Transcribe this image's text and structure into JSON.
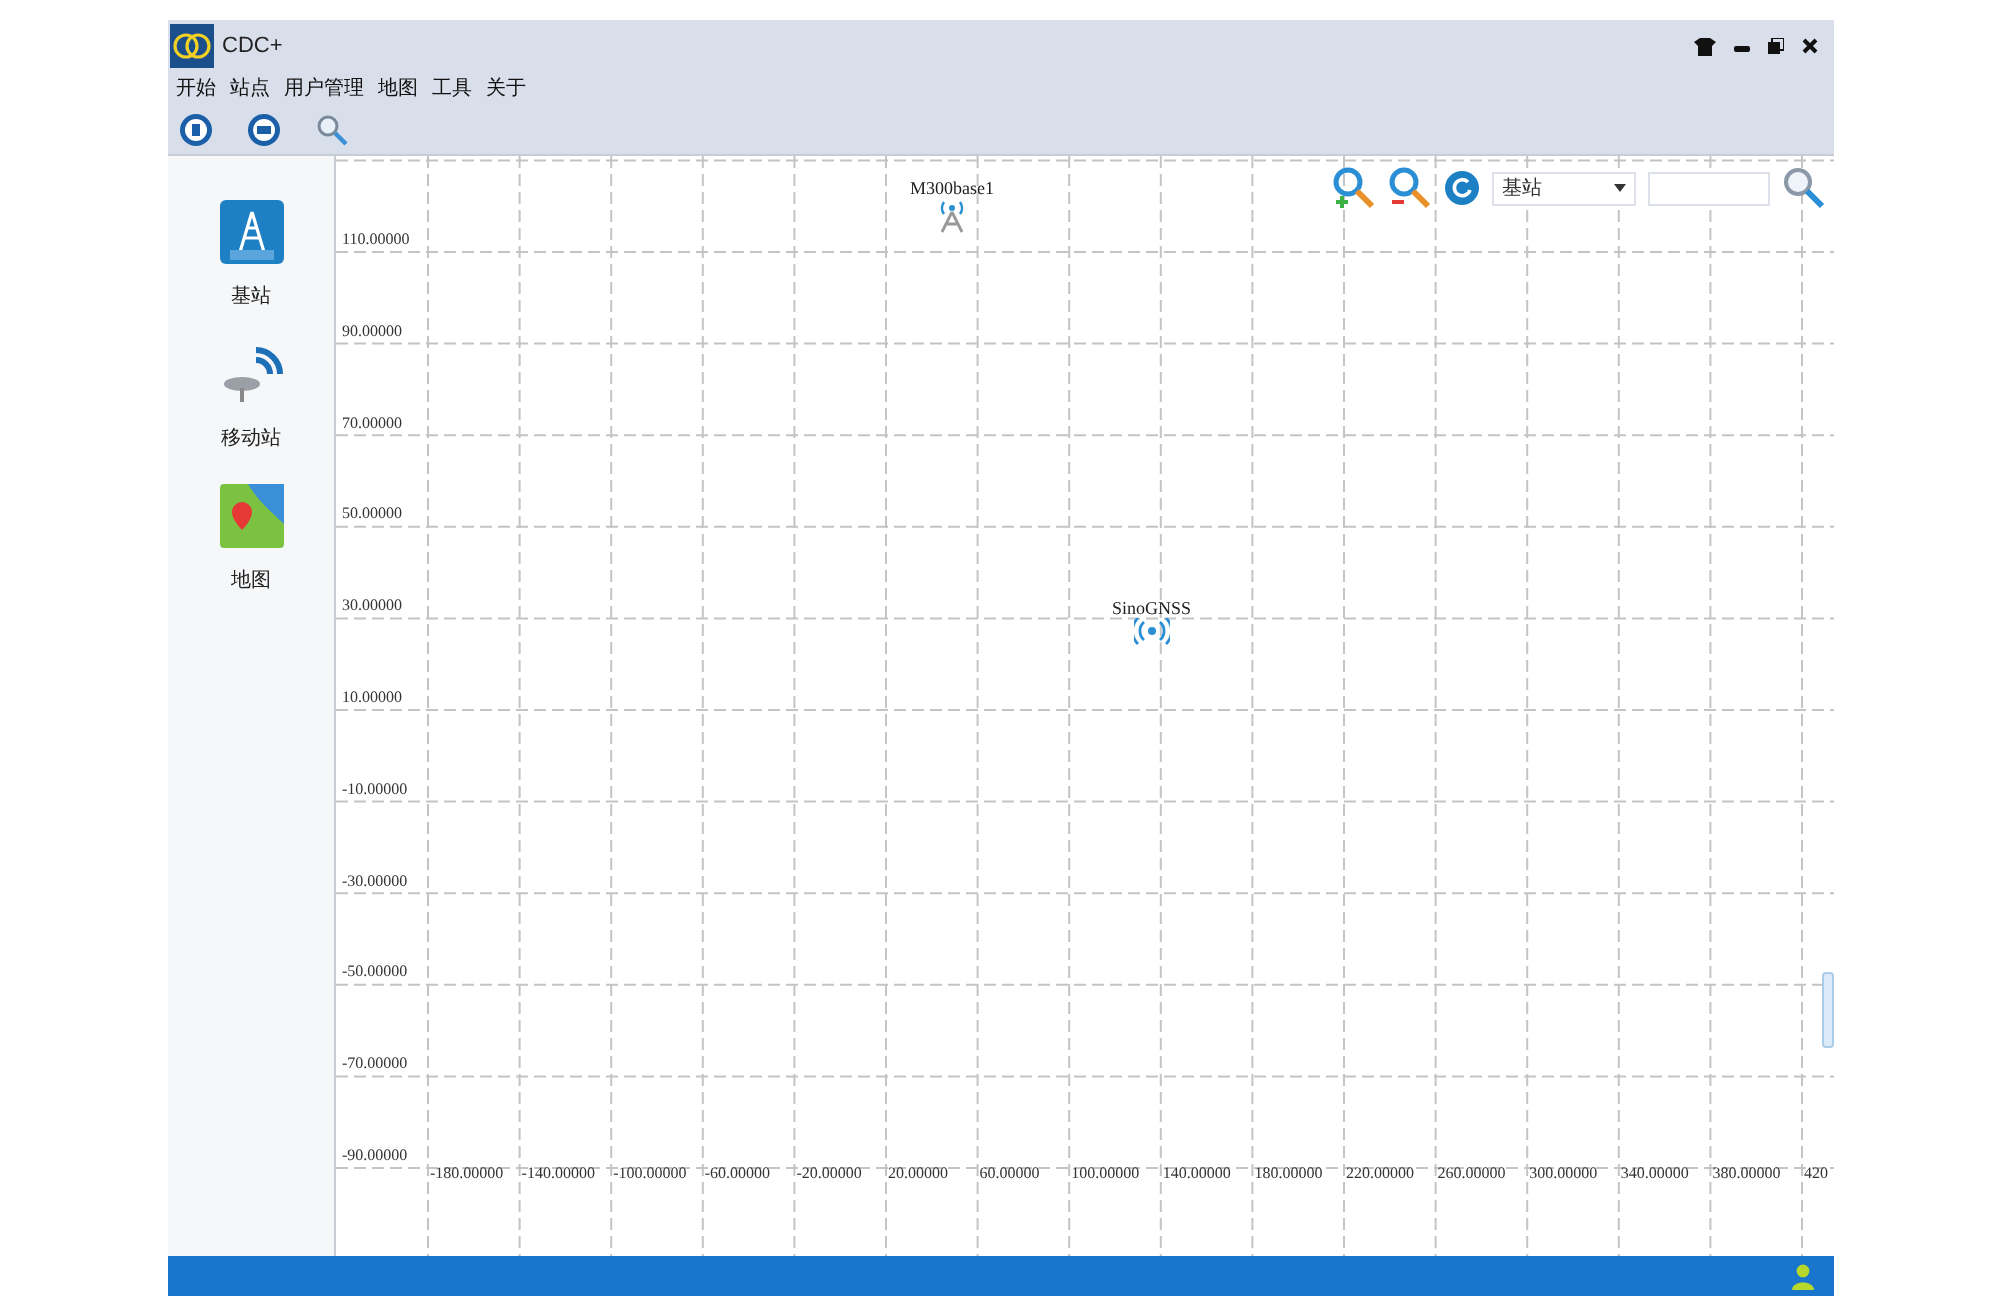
{
  "window": {
    "title": "CDC+"
  },
  "menu": [
    "开始",
    "站点",
    "用户管理",
    "地图",
    "工具",
    "关于"
  ],
  "sidebar": {
    "items": [
      {
        "label": "基站",
        "kind": "tower"
      },
      {
        "label": "移动站",
        "kind": "rover"
      },
      {
        "label": "地图",
        "kind": "map"
      }
    ]
  },
  "map": {
    "station_type": "基站",
    "y_labels": [
      "110.00000",
      "90.00000",
      "70.00000",
      "50.00000",
      "30.00000",
      "10.00000",
      "-10.00000",
      "-30.00000",
      "-50.00000",
      "-70.00000",
      "-90.00000"
    ],
    "x_labels": [
      "-180.00000",
      "-140.00000",
      "-100.00000",
      "-60.00000",
      "-20.00000",
      "20.00000",
      "60.00000",
      "100.00000",
      "140.00000",
      "180.00000",
      "220.00000",
      "260.00000",
      "300.00000",
      "340.00000",
      "380.00000",
      "420"
    ],
    "stations": [
      {
        "label": "M300base1",
        "kind": "base"
      },
      {
        "label": "SinoGNSS",
        "kind": "rover"
      }
    ]
  }
}
